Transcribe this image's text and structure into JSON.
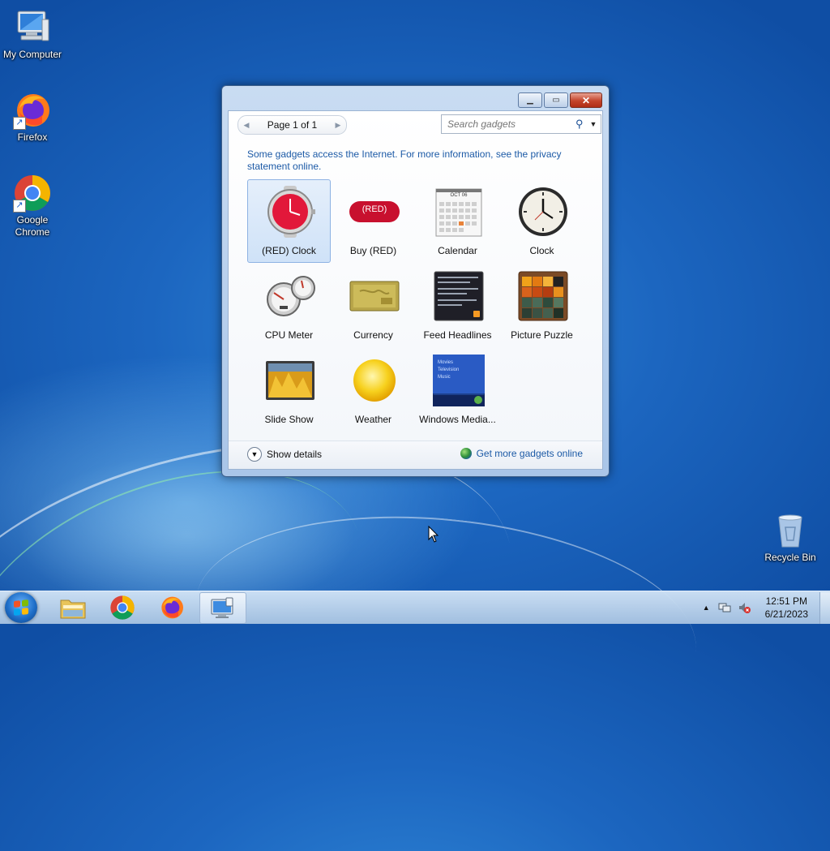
{
  "desktop": {
    "icons": [
      {
        "label": "My Computer"
      },
      {
        "label": "Firefox"
      },
      {
        "label": "Google Chrome"
      },
      {
        "label": "Recycle Bin"
      }
    ]
  },
  "window": {
    "pager": {
      "label": "Page 1 of 1"
    },
    "search": {
      "placeholder": "Search gadgets"
    },
    "notice": "Some gadgets access the Internet.  For more information, see the privacy statement online.",
    "gadgets": [
      {
        "label": "(RED) Clock"
      },
      {
        "label": "Buy (RED)"
      },
      {
        "label": "Calendar"
      },
      {
        "label": "Clock"
      },
      {
        "label": "CPU Meter"
      },
      {
        "label": "Currency"
      },
      {
        "label": "Feed Headlines"
      },
      {
        "label": "Picture Puzzle"
      },
      {
        "label": "Slide Show"
      },
      {
        "label": "Weather"
      },
      {
        "label": "Windows Media..."
      }
    ],
    "calendar_month": "OCT 06",
    "red_badge": "(RED)",
    "media_menu": [
      "Movies",
      "Television",
      "Music"
    ],
    "show_details": "Show details",
    "get_more": "Get more gadgets online"
  },
  "taskbar": {
    "time": "12:51 PM",
    "date": "6/21/2023"
  },
  "colors": {
    "link": "#1c5aa6",
    "desktop_blue": "#1c66c0",
    "selection": "#cfe2f8"
  }
}
